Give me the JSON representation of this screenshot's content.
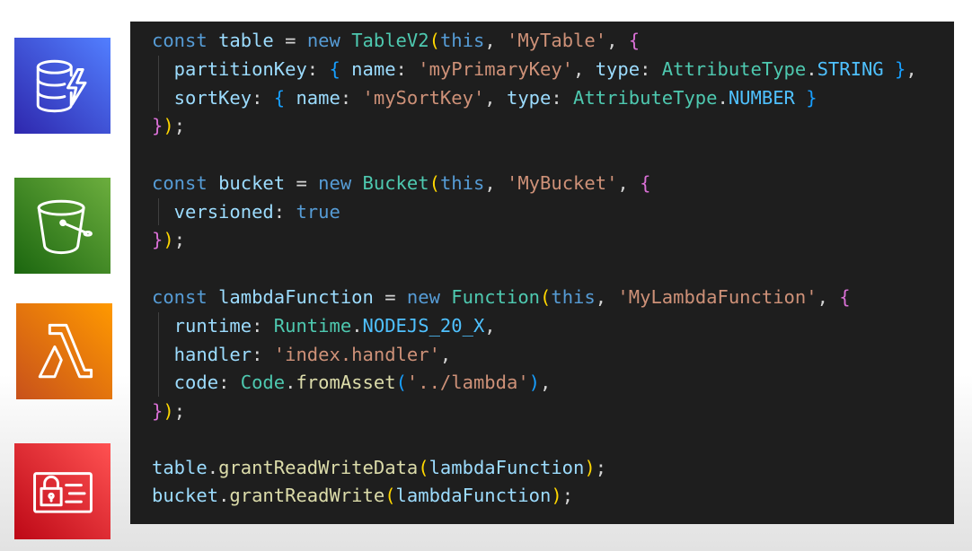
{
  "icons": [
    {
      "service": "Amazon DynamoDB",
      "icon": "dynamodb-icon",
      "color": "#3f48cc"
    },
    {
      "service": "Amazon S3",
      "icon": "s3-bucket-icon",
      "color": "#3f8624"
    },
    {
      "service": "AWS Lambda",
      "icon": "lambda-icon",
      "color": "#ed7100"
    },
    {
      "service": "AWS IAM",
      "icon": "iam-icon",
      "color": "#dd344c"
    }
  ],
  "editor": {
    "background": "#1e1e1e",
    "lines": [
      [
        {
          "t": "const",
          "c": "kw"
        },
        {
          "t": " ",
          "c": "pl"
        },
        {
          "t": "table",
          "c": "var"
        },
        {
          "t": " = ",
          "c": "pl"
        },
        {
          "t": "new",
          "c": "kw"
        },
        {
          "t": " ",
          "c": "pl"
        },
        {
          "t": "TableV2",
          "c": "cls"
        },
        {
          "t": "(",
          "c": "br1"
        },
        {
          "t": "this",
          "c": "kw"
        },
        {
          "t": ", ",
          "c": "pl"
        },
        {
          "t": "'MyTable'",
          "c": "str"
        },
        {
          "t": ", ",
          "c": "pl"
        },
        {
          "t": "{",
          "c": "br2"
        }
      ],
      [
        {
          "t": "  partitionKey",
          "c": "var"
        },
        {
          "t": ": ",
          "c": "pl"
        },
        {
          "t": "{",
          "c": "br3"
        },
        {
          "t": " name",
          "c": "var"
        },
        {
          "t": ": ",
          "c": "pl"
        },
        {
          "t": "'myPrimaryKey'",
          "c": "str"
        },
        {
          "t": ", ",
          "c": "pl"
        },
        {
          "t": "type",
          "c": "var"
        },
        {
          "t": ": ",
          "c": "pl"
        },
        {
          "t": "AttributeType",
          "c": "cls"
        },
        {
          "t": ".",
          "c": "pl"
        },
        {
          "t": "STRING",
          "c": "const"
        },
        {
          "t": " ",
          "c": "pl"
        },
        {
          "t": "}",
          "c": "br3"
        },
        {
          "t": ",",
          "c": "pl"
        }
      ],
      [
        {
          "t": "  sortKey",
          "c": "var"
        },
        {
          "t": ": ",
          "c": "pl"
        },
        {
          "t": "{",
          "c": "br3"
        },
        {
          "t": " name",
          "c": "var"
        },
        {
          "t": ": ",
          "c": "pl"
        },
        {
          "t": "'mySortKey'",
          "c": "str"
        },
        {
          "t": ", ",
          "c": "pl"
        },
        {
          "t": "type",
          "c": "var"
        },
        {
          "t": ": ",
          "c": "pl"
        },
        {
          "t": "AttributeType",
          "c": "cls"
        },
        {
          "t": ".",
          "c": "pl"
        },
        {
          "t": "NUMBER",
          "c": "const"
        },
        {
          "t": " ",
          "c": "pl"
        },
        {
          "t": "}",
          "c": "br3"
        }
      ],
      [
        {
          "t": "}",
          "c": "br2"
        },
        {
          "t": ")",
          "c": "br1"
        },
        {
          "t": ";",
          "c": "pl"
        }
      ],
      [],
      [
        {
          "t": "const",
          "c": "kw"
        },
        {
          "t": " ",
          "c": "pl"
        },
        {
          "t": "bucket",
          "c": "var"
        },
        {
          "t": " = ",
          "c": "pl"
        },
        {
          "t": "new",
          "c": "kw"
        },
        {
          "t": " ",
          "c": "pl"
        },
        {
          "t": "Bucket",
          "c": "cls"
        },
        {
          "t": "(",
          "c": "br1"
        },
        {
          "t": "this",
          "c": "kw"
        },
        {
          "t": ", ",
          "c": "pl"
        },
        {
          "t": "'MyBucket'",
          "c": "str"
        },
        {
          "t": ", ",
          "c": "pl"
        },
        {
          "t": "{",
          "c": "br2"
        }
      ],
      [
        {
          "t": "  versioned",
          "c": "var"
        },
        {
          "t": ": ",
          "c": "pl"
        },
        {
          "t": "true",
          "c": "kw"
        }
      ],
      [
        {
          "t": "}",
          "c": "br2"
        },
        {
          "t": ")",
          "c": "br1"
        },
        {
          "t": ";",
          "c": "pl"
        }
      ],
      [],
      [
        {
          "t": "const",
          "c": "kw"
        },
        {
          "t": " ",
          "c": "pl"
        },
        {
          "t": "lambdaFunction",
          "c": "var"
        },
        {
          "t": " = ",
          "c": "pl"
        },
        {
          "t": "new",
          "c": "kw"
        },
        {
          "t": " ",
          "c": "pl"
        },
        {
          "t": "Function",
          "c": "cls"
        },
        {
          "t": "(",
          "c": "br1"
        },
        {
          "t": "this",
          "c": "kw"
        },
        {
          "t": ", ",
          "c": "pl"
        },
        {
          "t": "'MyLambdaFunction'",
          "c": "str"
        },
        {
          "t": ", ",
          "c": "pl"
        },
        {
          "t": "{",
          "c": "br2"
        }
      ],
      [
        {
          "t": "  runtime",
          "c": "var"
        },
        {
          "t": ": ",
          "c": "pl"
        },
        {
          "t": "Runtime",
          "c": "cls"
        },
        {
          "t": ".",
          "c": "pl"
        },
        {
          "t": "NODEJS_20_X",
          "c": "const"
        },
        {
          "t": ",",
          "c": "pl"
        }
      ],
      [
        {
          "t": "  handler",
          "c": "var"
        },
        {
          "t": ": ",
          "c": "pl"
        },
        {
          "t": "'index.handler'",
          "c": "str"
        },
        {
          "t": ",",
          "c": "pl"
        }
      ],
      [
        {
          "t": "  code",
          "c": "var"
        },
        {
          "t": ": ",
          "c": "pl"
        },
        {
          "t": "Code",
          "c": "cls"
        },
        {
          "t": ".",
          "c": "pl"
        },
        {
          "t": "fromAsset",
          "c": "fn"
        },
        {
          "t": "(",
          "c": "br3"
        },
        {
          "t": "'../lambda'",
          "c": "str"
        },
        {
          "t": ")",
          "c": "br3"
        },
        {
          "t": ",",
          "c": "pl"
        }
      ],
      [
        {
          "t": "}",
          "c": "br2"
        },
        {
          "t": ")",
          "c": "br1"
        },
        {
          "t": ";",
          "c": "pl"
        }
      ],
      [],
      [
        {
          "t": "table",
          "c": "var"
        },
        {
          "t": ".",
          "c": "pl"
        },
        {
          "t": "grantReadWriteData",
          "c": "fn"
        },
        {
          "t": "(",
          "c": "br1"
        },
        {
          "t": "lambdaFunction",
          "c": "var"
        },
        {
          "t": ")",
          "c": "br1"
        },
        {
          "t": ";",
          "c": "pl"
        }
      ],
      [
        {
          "t": "bucket",
          "c": "var"
        },
        {
          "t": ".",
          "c": "pl"
        },
        {
          "t": "grantReadWrite",
          "c": "fn"
        },
        {
          "t": "(",
          "c": "br1"
        },
        {
          "t": "lambdaFunction",
          "c": "var"
        },
        {
          "t": ")",
          "c": "br1"
        },
        {
          "t": ";",
          "c": "pl"
        }
      ]
    ]
  }
}
